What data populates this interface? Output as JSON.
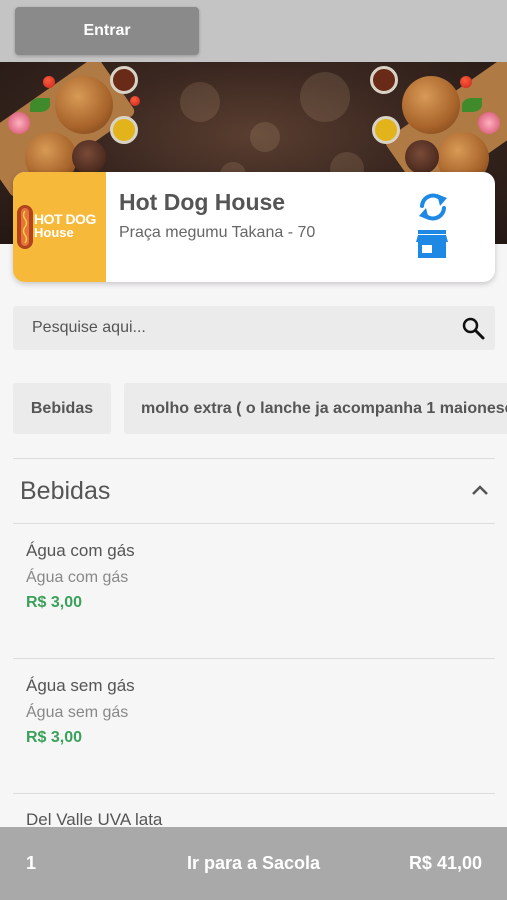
{
  "header": {
    "login_label": "Entrar"
  },
  "store": {
    "logo_line1": "HOT DOG",
    "logo_line2": "House",
    "name": "Hot Dog House",
    "address": "Praça megumu Takana - 70",
    "accent_color": "#1e88e5"
  },
  "search": {
    "placeholder": "Pesquise aqui..."
  },
  "categories": [
    "Bebidas",
    "molho extra ( o lanche ja acompanha 1 maionese"
  ],
  "section": {
    "title": "Bebidas",
    "products": [
      {
        "name": "Água com gás",
        "description": "Água com gás",
        "price": "R$ 3,00"
      },
      {
        "name": "Água sem gás",
        "description": "Água sem gás",
        "price": "R$ 3,00"
      },
      {
        "name": "Del Valle UVA lata"
      }
    ]
  },
  "bag": {
    "count": "1",
    "label": "Ir para a Sacola",
    "total": "R$ 41,00"
  },
  "colors": {
    "price": "#3aa15a",
    "logo_bg": "#f7b93a",
    "bag_bar": "#a9a9a9"
  }
}
